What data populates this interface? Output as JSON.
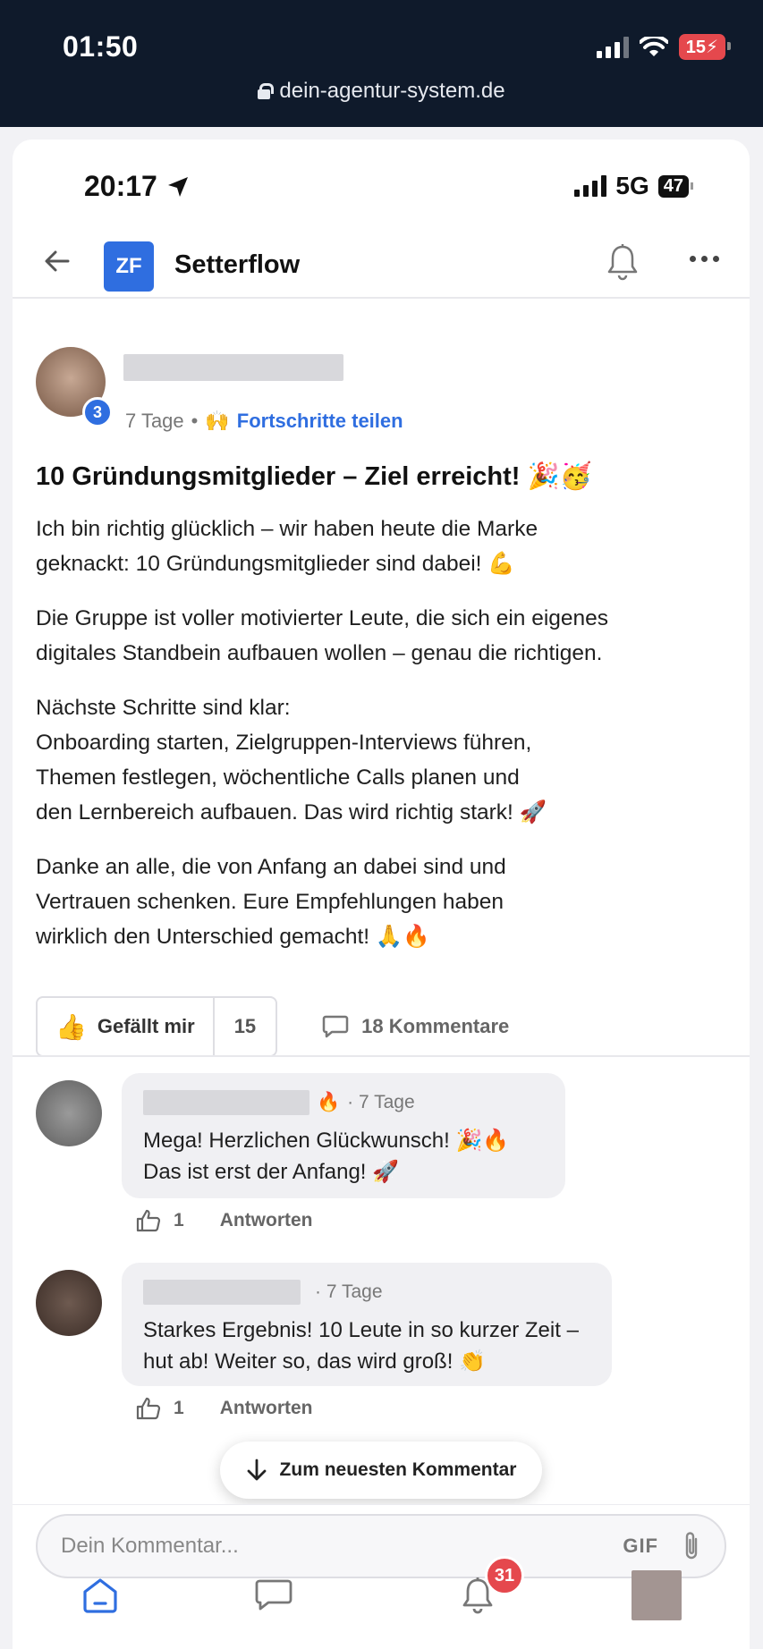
{
  "browser": {
    "time": "01:50",
    "battery": "15",
    "url": "dein-agentur-system.de"
  },
  "phone": {
    "time": "20:17",
    "network": "5G",
    "battery": "47"
  },
  "header": {
    "logo_text": "ZF",
    "title": "Setterflow"
  },
  "post": {
    "author_level": "3",
    "age": "7 Tage",
    "category_emoji": "🙌",
    "category": "Fortschritte teilen",
    "title": "10 Gründungsmitglieder – Ziel erreicht! 🎉🥳",
    "paragraphs": [
      "Ich bin richtig glücklich – wir haben heute die Marke\ngeknackt: 10 Gründungsmitglieder sind dabei! 💪",
      "Die Gruppe ist voller motivierter Leute, die sich ein eigenes\ndigitales Standbein aufbauen wollen – genau die richtigen.",
      "Nächste Schritte sind klar:\nOnboarding starten, Zielgruppen-Interviews führen,\nThemen festlegen, wöchentliche Calls planen und\nden Lernbereich aufbauen. Das wird richtig stark! 🚀",
      "Danke an alle, die von Anfang an dabei sind und\nVertrauen schenken. Eure Empfehlungen haben\nwirklich den Unterschied gemacht! 🙏🔥"
    ],
    "like_label": "Gefällt mir",
    "like_count": "15",
    "comments_label": "18 Kommentare"
  },
  "comments": [
    {
      "badge_emoji": "🔥",
      "age": "· 7 Tage",
      "text": "Mega! Herzlichen Glückwunsch! 🎉🔥\nDas ist erst der Anfang! 🚀",
      "likes": "1",
      "reply_label": "Antworten"
    },
    {
      "badge_emoji": "",
      "age": "· 7 Tage",
      "text": "Starkes Ergebnis! 10 Leute in so kurzer Zeit –\nhut ab! Weiter so, das wird groß! 👏",
      "likes": "1",
      "reply_label": "Antworten"
    }
  ],
  "jump_button": "Zum neuesten Kommentar",
  "composer": {
    "placeholder": "Dein Kommentar...",
    "gif_label": "GIF"
  },
  "tabbar": {
    "notifications_count": "31"
  },
  "colors": {
    "accent": "#2f6ee0",
    "badge_red": "#e5484d",
    "dark_bar": "#0f1a2b"
  }
}
